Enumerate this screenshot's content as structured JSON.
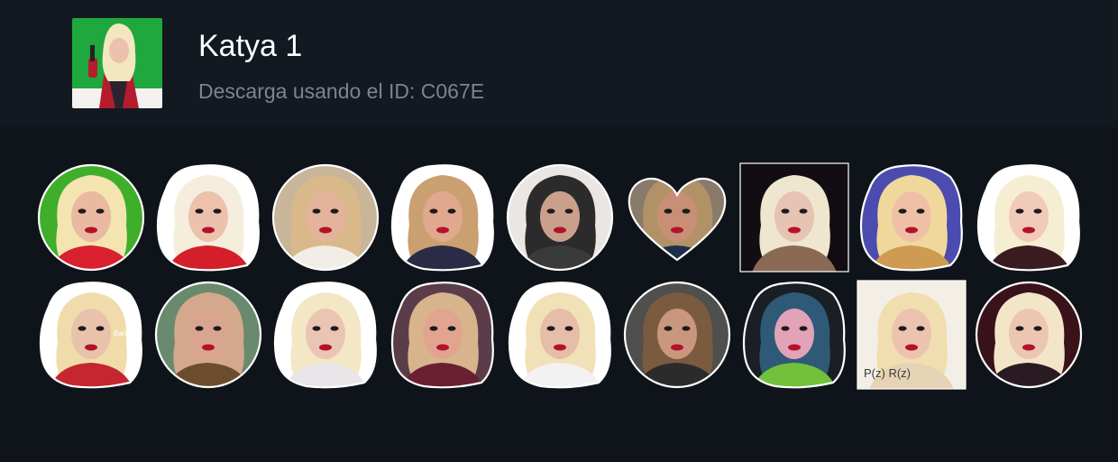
{
  "pack": {
    "title": "Katya 1",
    "subtitle": "Descarga usando el ID: C067E"
  },
  "thumbnail": {
    "icon": "pack-thumbnail",
    "background": "#1fa83d"
  },
  "stickers": [
    {
      "name": "sticker-1",
      "shape": "circle",
      "bg": "#3fae2a",
      "hair": "#f3e4b0",
      "skin": "#e9b9a2",
      "cloth": "#d8202f"
    },
    {
      "name": "sticker-2",
      "shape": "cutout",
      "bg": "#ffffff",
      "hair": "#f5eedc",
      "skin": "#ecc2ad",
      "cloth": "#d41f2a"
    },
    {
      "name": "sticker-3",
      "shape": "circle",
      "bg": "#c8b59a",
      "hair": "#d9b98a",
      "skin": "#e3b39b",
      "cloth": "#f2ede6"
    },
    {
      "name": "sticker-4",
      "shape": "cutout",
      "bg": "#ffffff",
      "hair": "#caa071",
      "skin": "#e0a98e",
      "cloth": "#2a2b44"
    },
    {
      "name": "sticker-5",
      "shape": "circle",
      "bg": "#e9e6e3",
      "hair": "#2b2b2b",
      "skin": "#caa08c",
      "cloth": "#3a3a3a"
    },
    {
      "name": "sticker-6",
      "shape": "heart",
      "bg": "#8a7a6b",
      "hair": "#b19266",
      "skin": "#c98f76",
      "cloth": "#1f2f4a"
    },
    {
      "name": "sticker-7",
      "shape": "square",
      "bg": "#120d12",
      "hair": "#efe6cf",
      "skin": "#e6c3b2",
      "cloth": "#8a6a55"
    },
    {
      "name": "sticker-8",
      "shape": "cutout",
      "bg": "#4b4bb0",
      "hair": "#f0d89c",
      "skin": "#efc0a6",
      "cloth": "#cf9a52"
    },
    {
      "name": "sticker-9",
      "shape": "cutout",
      "bg": "#ffffff",
      "hair": "#f6eed2",
      "skin": "#f1cbb9",
      "cloth": "#3a1b1f"
    },
    {
      "name": "sticker-10",
      "shape": "cutout",
      "bg": "#ffffff",
      "hair": "#f0dcab",
      "skin": "#e9c2ab",
      "cloth": "#c6262f",
      "caption": "Barbara\nwhat?"
    },
    {
      "name": "sticker-11",
      "shape": "circle",
      "bg": "#6a8a6e",
      "hair": "#d4a88c",
      "skin": "#d9a58e",
      "cloth": "#6b4c2f"
    },
    {
      "name": "sticker-12",
      "shape": "cutout",
      "bg": "#ffffff",
      "hair": "#f3e7c6",
      "skin": "#eac5b3",
      "cloth": "#e9e6ea"
    },
    {
      "name": "sticker-13",
      "shape": "cutout",
      "bg": "#5b3d4a",
      "hair": "#d7b48c",
      "skin": "#e1a58f",
      "cloth": "#6a2030"
    },
    {
      "name": "sticker-14",
      "shape": "cutout",
      "bg": "#ffffff",
      "hair": "#f1e1b6",
      "skin": "#e6bda7",
      "cloth": "#f2f2f2"
    },
    {
      "name": "sticker-15",
      "shape": "circle",
      "bg": "#4f4f4d",
      "hair": "#7a5b40",
      "skin": "#c9977d",
      "cloth": "#2b2b2b"
    },
    {
      "name": "sticker-16",
      "shape": "cutout",
      "bg": "#1a1f25",
      "hair": "#2e5a78",
      "skin": "#e2a2b8",
      "cloth": "#71c23a"
    },
    {
      "name": "sticker-17",
      "shape": "square",
      "bg": "#f3efe6",
      "hair": "#f0deb0",
      "skin": "#ecc3ae",
      "cloth": "#e6d3b5",
      "caption": "P(z)  R(z)"
    },
    {
      "name": "sticker-18",
      "shape": "circle",
      "bg": "#3a1219",
      "hair": "#f3e6c8",
      "skin": "#ecc6b3",
      "cloth": "#2a1a22"
    }
  ]
}
